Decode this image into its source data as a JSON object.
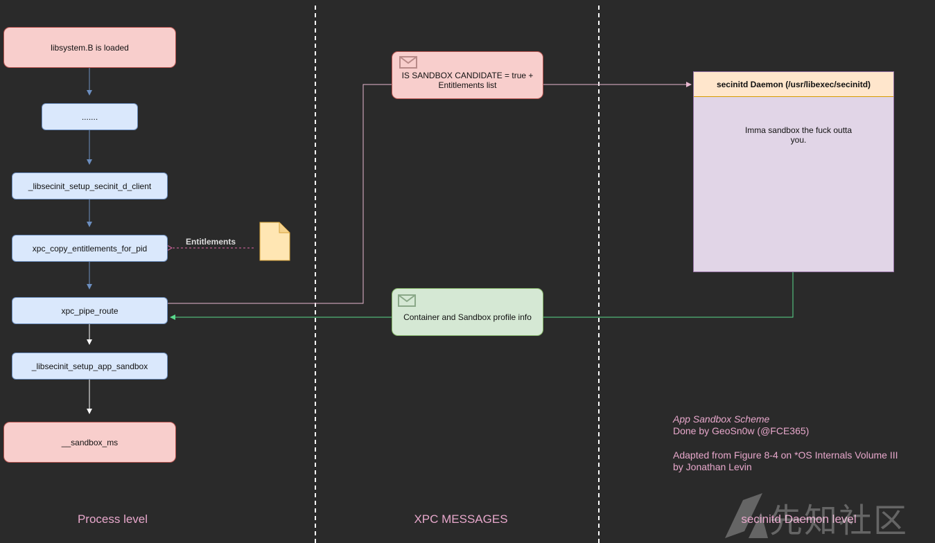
{
  "lanes": {
    "process": "Process level",
    "xpc": "XPC MESSAGES",
    "daemon": "secinitd Daemon level"
  },
  "process_nodes": {
    "libsystem": "libsystem.B is loaded",
    "dots": ".......",
    "setup_client": "_libsecinit_setup_secinit_d_client",
    "copy_entitlements": "xpc_copy_entitlements_for_pid",
    "pipe_route": "xpc_pipe_route",
    "setup_sandbox": "_libsecinit_setup_app_sandbox",
    "sandbox_ms": "__sandbox_ms"
  },
  "entitlements_label": "Entitlements",
  "messages": {
    "candidate": "IS SANDBOX CANDIDATE = true + Entitlements list",
    "container": "Container and Sandbox profile info"
  },
  "daemon": {
    "title": "secinitd Daemon (/usr/libexec/secinitd)",
    "speech": "Imma sandbox the fuck outta you."
  },
  "credits": {
    "title": "App Sandbox Scheme",
    "author": "Done by GeoSn0w (@FCE365)",
    "adapted": "Adapted from Figure 8-4 on *OS Internals Volume III",
    "by": "by Jonathan Levin"
  },
  "watermark": "先知社区",
  "colors": {
    "background": "#2a2a2a",
    "lane_text": "#e8a8cc",
    "arrow_blue": "#6c8ebf",
    "arrow_white": "#ffffff",
    "arrow_green": "#59d98c",
    "arrow_pink": "#e8b8d0"
  }
}
